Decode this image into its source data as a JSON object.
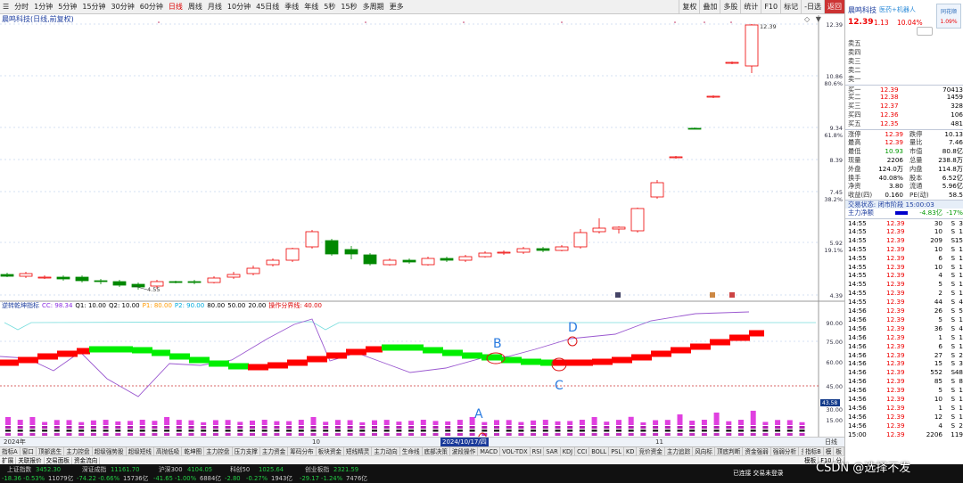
{
  "toolbar": {
    "periods": [
      "分时",
      "1分钟",
      "5分钟",
      "15分钟",
      "30分钟",
      "60分钟",
      "日线",
      "周线",
      "月线",
      "10分钟",
      "45日线",
      "季线",
      "年线",
      "5秒",
      "15秒",
      "多周期",
      "更多"
    ],
    "active_period": "日线",
    "right_buttons": [
      "复权",
      "叠加",
      "多股",
      "统计",
      "F10",
      "标记",
      "-日选",
      "返回"
    ]
  },
  "chart_title": "晨鸣科技(日线,前复权)",
  "chart_controls": "◇ ▼",
  "price_axis": [
    "12.39",
    "10.86",
    "80.6%",
    "9.34",
    "61.8%",
    "8.39",
    "7.45",
    "38.2%",
    "5.92",
    "19.1%",
    "4.39"
  ],
  "annotations": {
    "high_label": "12.39",
    "low_label": "4.55",
    "markers": [
      "D",
      "B",
      "A",
      "C"
    ]
  },
  "indicator_legend": {
    "name": "逆转乾坤指标",
    "items": [
      "CC: 98.34",
      "Q1: 10.00",
      "Q2: 10.00",
      "P1: 80.00",
      "P2: 90.00",
      "80.00",
      "50.00",
      "20.00",
      "操作分界线: 40.00"
    ],
    "colors": [
      "#8a2be2",
      "#000000",
      "#000000",
      "#ff9900",
      "#00aadd",
      "#000000",
      "#000000",
      "#000000",
      "#dd0000"
    ]
  },
  "indicator_axis": [
    "90.00",
    "75.00",
    "60.00",
    "45.00",
    "30.00",
    "15.00"
  ],
  "indicator_readout": "43.58",
  "date_axis": {
    "labels": [
      "2024年",
      "10",
      "11"
    ],
    "selected": "2024/10/17/四",
    "right_label": "日线"
  },
  "indicator_tabs": [
    "指标A",
    "窗口",
    "顶部逃生",
    "主力控盘",
    "超级强势股",
    "超级短线",
    "高抛低吸",
    "乾坤图",
    "主力控盘",
    "压力支撑",
    "主力资金",
    "筹码分布",
    "板块资金",
    "短线精灵",
    "主力动向",
    "生命线",
    "底部决策",
    "波段操作",
    "MACD",
    "VOL-TDX",
    "RSI",
    "SAR",
    "KDJ",
    "CCI",
    "BOLL",
    "PSL",
    "KD",
    "竞价资金",
    "主力追踪",
    "风向标",
    "顶底判断",
    "资金强弱",
    "强弱分析",
    "多空趋势",
    "神奇九转",
    "趋势导航"
  ],
  "tabs_right": [
    "指标B",
    "模",
    "板"
  ],
  "bottom_tabs": [
    "扩展",
    "关联报价",
    "交易面板",
    "资金流向"
  ],
  "right_extra": [
    "模板",
    "F10",
    "分"
  ],
  "stock": {
    "name": "晨鸣科技",
    "tag": "医药+机器人",
    "price": "12.39",
    "change": "1.13",
    "change_pct": "10.04%",
    "mini_pct": "1.09%",
    "mini_label": "同花顺"
  },
  "sell_book": [
    {
      "label": "卖五",
      "price": "",
      "vol": ""
    },
    {
      "label": "卖四",
      "price": "",
      "vol": ""
    },
    {
      "label": "卖三",
      "price": "",
      "vol": ""
    },
    {
      "label": "卖二",
      "price": "",
      "vol": ""
    },
    {
      "label": "卖一",
      "price": "",
      "vol": ""
    }
  ],
  "buy_book": [
    {
      "label": "买一",
      "price": "12.39",
      "vol": "70413"
    },
    {
      "label": "买二",
      "price": "12.38",
      "vol": "1459"
    },
    {
      "label": "买三",
      "price": "12.37",
      "vol": "328"
    },
    {
      "label": "买四",
      "price": "12.36",
      "vol": "106"
    },
    {
      "label": "买五",
      "price": "12.35",
      "vol": "481"
    }
  ],
  "stats": [
    {
      "l1": "涨停",
      "v1": "12.39",
      "l2": "跌停",
      "v2": "10.13"
    },
    {
      "l1": "最高",
      "v1": "12.39",
      "l2": "量比",
      "v2": "7.46"
    },
    {
      "l1": "最低",
      "v1": "10.93",
      "l2": "市值",
      "v2": "80.8亿"
    },
    {
      "l1": "现量",
      "v1": "2206",
      "l2": "总量",
      "v2": "238.8万"
    },
    {
      "l1": "外盘",
      "v1": "124.0万",
      "l2": "内盘",
      "v2": "114.8万"
    },
    {
      "l1": "换手",
      "v1": "40.08%",
      "l2": "股本",
      "v2": "6.52亿"
    },
    {
      "l1": "净资",
      "v1": "3.80",
      "l2": "流通",
      "v2": "5.96亿"
    },
    {
      "l1": "收益(四)",
      "v1": "0.160",
      "l2": "PE(动)",
      "v2": "58.5"
    }
  ],
  "trade_status": "交易状态: 闭市阶段 15:00:03",
  "main_flow": {
    "label": "主力净额",
    "value": "-4.83亿",
    "pct": "-17%"
  },
  "ticks": [
    [
      "14:55",
      "12.39",
      "30",
      "S",
      "3"
    ],
    [
      "14:55",
      "12.39",
      "10",
      "S",
      "1"
    ],
    [
      "14:55",
      "12.39",
      "209",
      "S",
      "15"
    ],
    [
      "14:55",
      "12.39",
      "10",
      "S",
      "1"
    ],
    [
      "14:55",
      "12.39",
      "6",
      "S",
      "1"
    ],
    [
      "14:55",
      "12.39",
      "10",
      "S",
      "1"
    ],
    [
      "14:55",
      "12.39",
      "4",
      "S",
      "1"
    ],
    [
      "14:55",
      "12.39",
      "5",
      "S",
      "1"
    ],
    [
      "14:55",
      "12.39",
      "2",
      "S",
      "1"
    ],
    [
      "14:55",
      "12.39",
      "44",
      "S",
      "4"
    ],
    [
      "14:56",
      "12.39",
      "26",
      "S",
      "5"
    ],
    [
      "14:56",
      "12.39",
      "5",
      "S",
      "1"
    ],
    [
      "14:56",
      "12.39",
      "36",
      "S",
      "4"
    ],
    [
      "14:56",
      "12.39",
      "1",
      "S",
      "1"
    ],
    [
      "14:56",
      "12.39",
      "6",
      "S",
      "1"
    ],
    [
      "14:56",
      "12.39",
      "27",
      "S",
      "2"
    ],
    [
      "14:56",
      "12.39",
      "15",
      "S",
      "3"
    ],
    [
      "14:56",
      "12.39",
      "552",
      "S",
      "48"
    ],
    [
      "14:56",
      "12.39",
      "85",
      "S",
      "8"
    ],
    [
      "14:56",
      "12.39",
      "5",
      "S",
      "1"
    ],
    [
      "14:56",
      "12.39",
      "10",
      "S",
      "1"
    ],
    [
      "14:56",
      "12.39",
      "1",
      "S",
      "1"
    ],
    [
      "14:56",
      "12.39",
      "12",
      "S",
      "1"
    ],
    [
      "14:56",
      "12.39",
      "4",
      "S",
      "2"
    ],
    [
      "15:00",
      "12.39",
      "2206",
      "",
      "119"
    ]
  ],
  "indices": [
    {
      "name": "上证指数",
      "v": "3452.30",
      "ch": "-18.36",
      "pct": "-0.53%",
      "amt": "11079亿"
    },
    {
      "name": "深证成指",
      "v": "11161.70",
      "ch": "-74.22",
      "pct": "-0.66%",
      "amt": "15736亿"
    },
    {
      "name": "沪深300",
      "v": "4104.05",
      "ch": "-41.65",
      "pct": "-1.00%",
      "amt": "6884亿"
    },
    {
      "name": "科创50",
      "v": "1025.64",
      "ch": "-2.80",
      "pct": "-0.27%",
      "amt": "1943亿"
    },
    {
      "name": "创业板指",
      "v": "2321.59",
      "ch": "-29.17",
      "pct": "-1.24%",
      "amt": "7476亿"
    }
  ],
  "status_msg": "已连接 交易未登录",
  "watermark": "CSDN @选择不发",
  "colors": {
    "up": "#ee0000",
    "down": "#008800",
    "line_up": "#ff0000",
    "line_down": "#00ee00",
    "purple": "#9b59d0"
  }
}
